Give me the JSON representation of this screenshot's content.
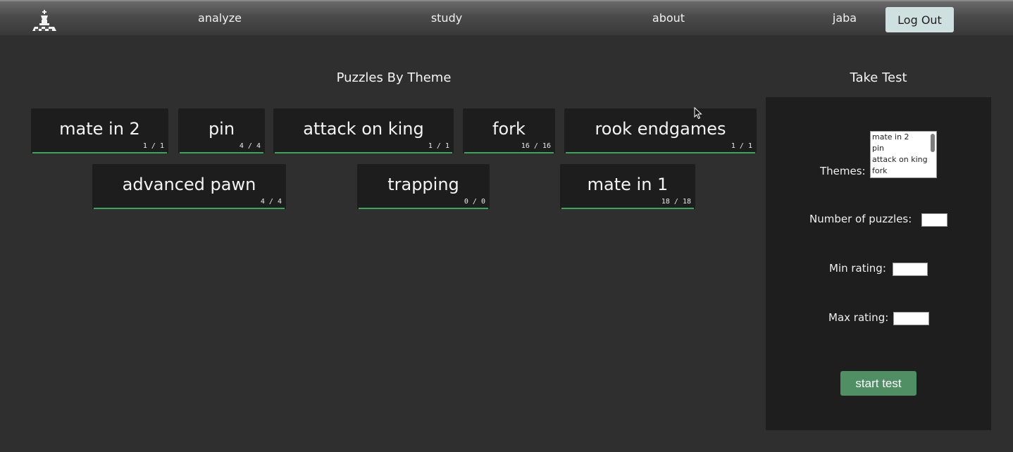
{
  "nav": {
    "links": [
      "analyze",
      "study",
      "about"
    ],
    "user": "jaba",
    "logout_label": "Log Out"
  },
  "puzzles": {
    "title": "Puzzles By Theme",
    "themes": [
      {
        "label": "mate in 2",
        "count": "1 / 1",
        "progress": 1.0
      },
      {
        "label": "pin",
        "count": "4 / 4",
        "progress": 1.0
      },
      {
        "label": "attack on king",
        "count": "1 / 1",
        "progress": 1.0
      },
      {
        "label": "fork",
        "count": "16 / 16",
        "progress": 1.0
      },
      {
        "label": "rook endgames",
        "count": "1 / 1",
        "progress": 1.0
      },
      {
        "label": "advanced pawn",
        "count": "4 / 4",
        "progress": 1.0
      },
      {
        "label": "trapping",
        "count": "0 / 0",
        "progress": 1.0
      },
      {
        "label": "mate in 1",
        "count": "18 / 18",
        "progress": 1.0
      }
    ]
  },
  "test": {
    "title": "Take Test",
    "themes_label": "Themes:",
    "theme_options": [
      "mate in 2",
      "pin",
      "attack on king",
      "fork"
    ],
    "num_puzzles_label": "Number of puzzles:",
    "num_puzzles_value": "",
    "min_rating_label": "Min rating:",
    "min_rating_value": "",
    "max_rating_label": "Max rating:",
    "max_rating_value": "",
    "start_label": "start test"
  },
  "colors": {
    "background": "#2f2f2f",
    "tile": "#1d1d1d",
    "progress": "#3aa65a",
    "start_button": "#4f8f63",
    "logout_button": "#cfe0e0"
  }
}
